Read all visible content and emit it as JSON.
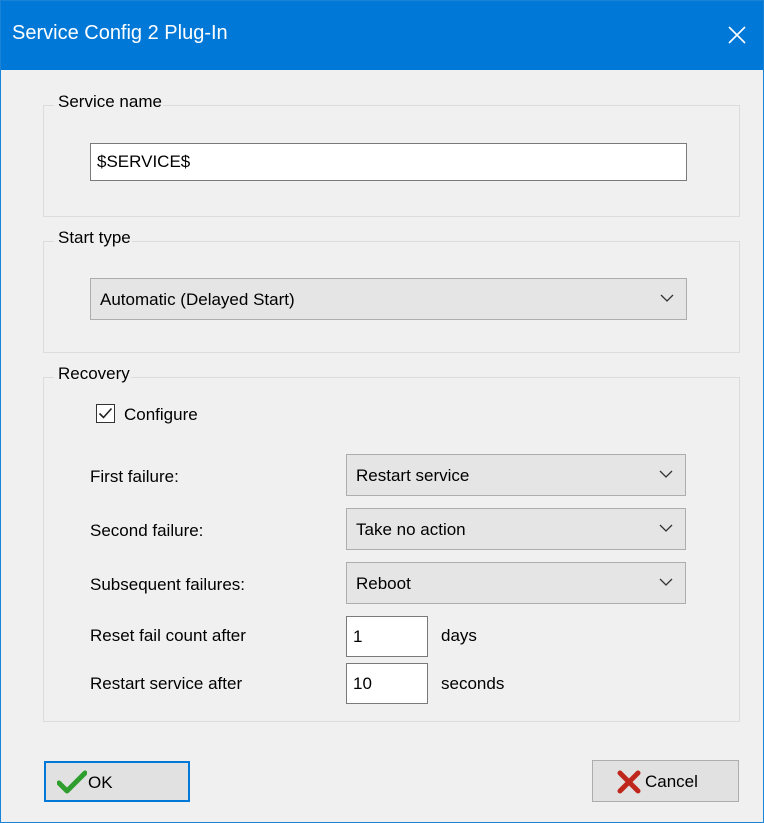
{
  "window": {
    "title": "Service Config 2 Plug-In"
  },
  "service_name": {
    "group_label": "Service name",
    "value": "$SERVICE$"
  },
  "start_type": {
    "group_label": "Start type",
    "selected": "Automatic (Delayed Start)"
  },
  "recovery": {
    "group_label": "Recovery",
    "configure_label": "Configure",
    "configure_checked": true,
    "first_failure_label": "First failure:",
    "first_failure_value": "Restart service",
    "second_failure_label": "Second failure:",
    "second_failure_value": "Take no action",
    "subsequent_failures_label": "Subsequent failures:",
    "subsequent_failures_value": "Reboot",
    "reset_label": "Reset fail count after",
    "reset_value": "1",
    "reset_unit": "days",
    "restart_label": "Restart service after",
    "restart_value": "10",
    "restart_unit": "seconds"
  },
  "buttons": {
    "ok_label": "OK",
    "cancel_label": "Cancel"
  },
  "icons": {
    "ok": "checkmark-icon",
    "cancel": "x-icon",
    "close": "close-icon",
    "dropdown": "chevron-down-icon"
  },
  "colors": {
    "title_bar": "#0078d7",
    "ok_check": "#2e9e2e",
    "cancel_x": "#c0271c"
  }
}
